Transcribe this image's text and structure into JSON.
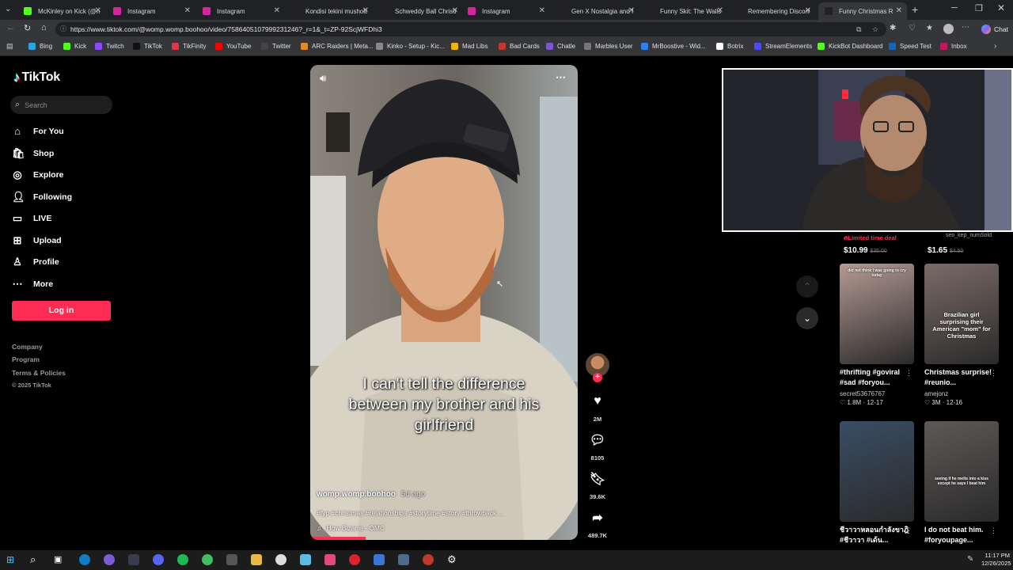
{
  "browser": {
    "tabs": [
      {
        "title": "McKinley on Kick (@m",
        "color": "#53fc18"
      },
      {
        "title": "Instagram",
        "color": "#d6249f"
      },
      {
        "title": "Instagram",
        "color": "#d6249f"
      },
      {
        "title": "Kondisi tekini mushola",
        "color": "#222222"
      },
      {
        "title": "Schweddy Ball Christm",
        "color": "#222222"
      },
      {
        "title": "Instagram",
        "color": "#d6249f"
      },
      {
        "title": "Gen X Nostalgia and M",
        "color": "#222222"
      },
      {
        "title": "Funny Skit: The Walls H",
        "color": "#222222"
      },
      {
        "title": "Remembering Discont",
        "color": "#222222"
      },
      {
        "title": "Funny Christmas R",
        "color": "#222222"
      }
    ],
    "url": "https://www.tiktok.com/@womp.womp.boohoo/video/7586405107999231246?_r=1&_t=ZP-92ScjWFDhi3",
    "chat_label": "Chat",
    "bookmarks": [
      {
        "label": "Bing",
        "color": "#2aa5e0"
      },
      {
        "label": "Kick",
        "color": "#53fc18"
      },
      {
        "label": "Twitch",
        "color": "#9146ff"
      },
      {
        "label": "TikTok",
        "color": "#111111"
      },
      {
        "label": "TikFinity",
        "color": "#e5334b"
      },
      {
        "label": "YouTube",
        "color": "#ff0000"
      },
      {
        "label": "Twitter",
        "color": "#444444"
      },
      {
        "label": "ARC Raiders | Meta...",
        "color": "#e08a2a"
      },
      {
        "label": "Kinko - Setup - Kic...",
        "color": "#888888"
      },
      {
        "label": "Mad Libs",
        "color": "#f0b400"
      },
      {
        "label": "Bad Cards",
        "color": "#c0392b"
      },
      {
        "label": "Chatle",
        "color": "#7a57d1"
      },
      {
        "label": "Marbles User",
        "color": "#777777"
      },
      {
        "label": "MrBoostive - Wid...",
        "color": "#2f80ed"
      },
      {
        "label": "Botrix",
        "color": "#ffffff"
      },
      {
        "label": "StreamElements",
        "color": "#4a4aff"
      },
      {
        "label": "KickBot Dashboard",
        "color": "#53fc18"
      },
      {
        "label": "Speed Test",
        "color": "#1565c0"
      },
      {
        "label": "Inbox",
        "color": "#c2185b"
      }
    ]
  },
  "sidebar": {
    "logo": "TikTok",
    "search_placeholder": "Search",
    "items": [
      {
        "label": "For You",
        "icon": "home-icon"
      },
      {
        "label": "Shop",
        "icon": "shop-icon"
      },
      {
        "label": "Explore",
        "icon": "compass-icon"
      },
      {
        "label": "Following",
        "icon": "following-icon"
      },
      {
        "label": "LIVE",
        "icon": "live-icon"
      },
      {
        "label": "Upload",
        "icon": "upload-icon"
      },
      {
        "label": "Profile",
        "icon": "profile-icon"
      },
      {
        "label": "More",
        "icon": "more-icon"
      }
    ],
    "login": "Log in",
    "footer": [
      "Company",
      "Program",
      "Terms & Policies",
      "© 2025 TikTok"
    ]
  },
  "video": {
    "caption_line1": "I can't tell the difference",
    "caption_line2": "between my brother and his",
    "caption_line3": "girlfriend",
    "author": "womp.womp.boohoo",
    "time_ago": "5d ago",
    "hashtags": "#fyp #christmas #relationships #storytime #story #throwback ...",
    "sound": "How Bizarre - OMC"
  },
  "actions": {
    "likes": "2M",
    "comments": "8105",
    "saves": "39.6K",
    "shares": "489.7K"
  },
  "shop": [
    {
      "badge": "Limited time deal",
      "price": "$10.99",
      "old_price": "$35.00"
    },
    {
      "seller": "seo_kep_numSold",
      "price": "$1.65",
      "old_price": "$4.50"
    }
  ],
  "related": [
    {
      "overlay": "did not think I was going to cry today",
      "caption": "#thrifting #goviral #sad #foryou...",
      "author": "secret53676767",
      "likes": "1.8M",
      "date": "12-17",
      "color": "#b49a92"
    },
    {
      "overlay": "Brazilian girl surprising their American \"mom\" for Christmas",
      "caption": "Christmas surprise! #reunio...",
      "author": "amejonz",
      "likes": "3M",
      "date": "12-16",
      "color": "#7b6b67"
    },
    {
      "overlay": "",
      "caption": "ชีวาวาหลอนกำลังขาฎิ #ชีวาวา #เด้น...",
      "author": "",
      "likes": "",
      "date": "",
      "color": "#3a4d64"
    },
    {
      "overlay": "seeing if he melts into a kiss except he says I beat him",
      "caption": "I do not beat him. #foryoupage...",
      "author": "",
      "likes": "",
      "date": "",
      "color": "#5e5957"
    }
  ],
  "taskbar": {
    "time": "11:17 PM",
    "date": "12/26/2025"
  }
}
